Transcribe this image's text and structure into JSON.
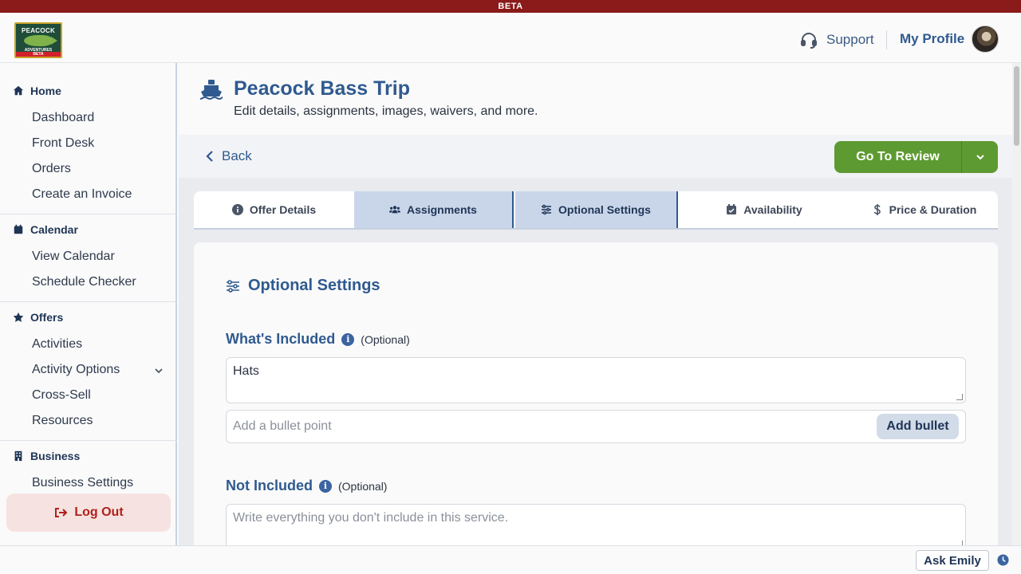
{
  "beta_banner": "BETA",
  "logo": {
    "line1": "PEACOCK",
    "line2": "ADVENTURES",
    "line3": "BETA"
  },
  "header": {
    "support_label": "Support",
    "profile_label": "My Profile"
  },
  "sidebar": {
    "home": {
      "title": "Home",
      "items": [
        "Dashboard",
        "Front Desk",
        "Orders",
        "Create an Invoice"
      ]
    },
    "calendar": {
      "title": "Calendar",
      "items": [
        "View Calendar",
        "Schedule Checker"
      ]
    },
    "offers": {
      "title": "Offers",
      "items": [
        "Activities",
        "Activity Options",
        "Cross-Sell",
        "Resources"
      ]
    },
    "business": {
      "title": "Business",
      "items": [
        "Business Settings"
      ]
    },
    "logout_label": "Log Out"
  },
  "page": {
    "title": "Peacock Bass Trip",
    "subtitle": "Edit details, assignments, images, waivers, and more.",
    "back_label": "Back",
    "review_label": "Go To Review"
  },
  "tabs": [
    {
      "label": "Offer Details",
      "icon": "info-icon"
    },
    {
      "label": "Assignments",
      "icon": "users-icon"
    },
    {
      "label": "Optional Settings",
      "icon": "sliders-icon"
    },
    {
      "label": "Availability",
      "icon": "calendar-check-icon"
    },
    {
      "label": "Price & Duration",
      "icon": "dollar-icon"
    }
  ],
  "section": {
    "title": "Optional Settings",
    "included": {
      "label": "What's Included",
      "optional": "(Optional)",
      "value": "Hats",
      "bullet_placeholder": "Add a bullet point",
      "add_label": "Add bullet"
    },
    "not_included": {
      "label": "Not Included",
      "optional": "(Optional)",
      "placeholder": "Write everything you don't include in this service."
    }
  },
  "footer": {
    "ask_label": "Ask Emily"
  },
  "colors": {
    "accent": "#2f5a8f",
    "success": "#5e9a32",
    "beta": "#8b1a1a",
    "danger": "#b0201a"
  }
}
